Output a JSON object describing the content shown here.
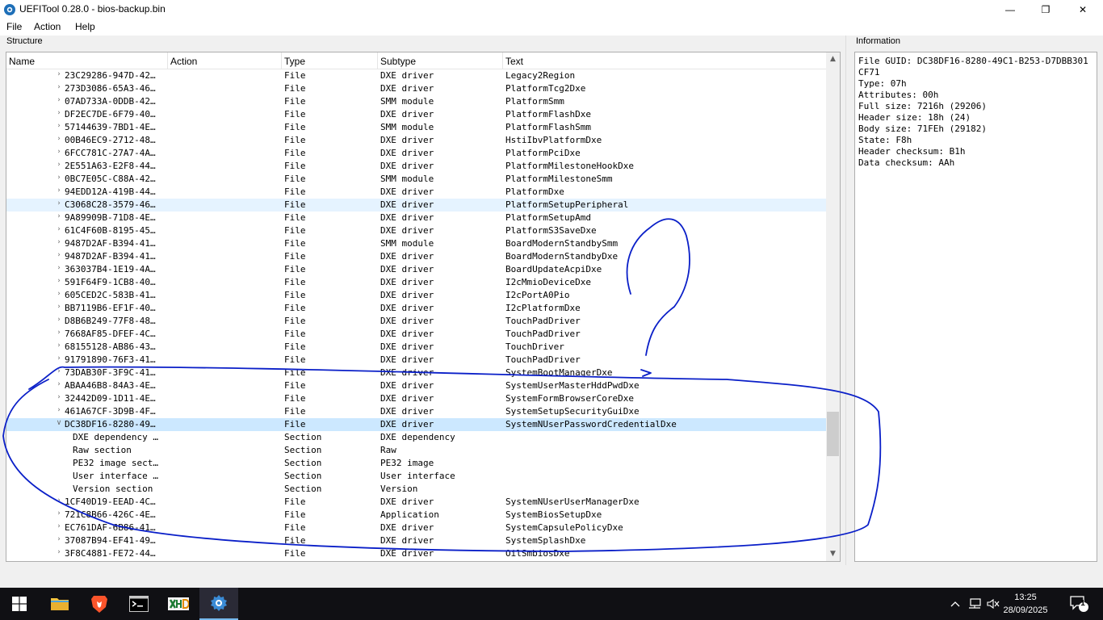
{
  "window": {
    "title": "UEFITool 0.28.0 - bios-backup.bin",
    "minimize_glyph": "—",
    "maximize_glyph": "❐",
    "close_glyph": "✕"
  },
  "menu": [
    "File",
    "Action",
    "Help"
  ],
  "structure_title": "Structure",
  "information_title": "Information",
  "columns": {
    "name": "Name",
    "action": "Action",
    "type": "Type",
    "subtype": "Subtype",
    "text": "Text"
  },
  "rows": [
    {
      "name": "23C29286-947D-42…",
      "type": "File",
      "subtype": "DXE driver",
      "text": "Legacy2Region",
      "level": 0,
      "expander": "collapsed"
    },
    {
      "name": "273D3086-65A3-46…",
      "type": "File",
      "subtype": "DXE driver",
      "text": "PlatformTcg2Dxe",
      "level": 0,
      "expander": "collapsed"
    },
    {
      "name": "07AD733A-0DDB-42…",
      "type": "File",
      "subtype": "SMM module",
      "text": "PlatformSmm",
      "level": 0,
      "expander": "collapsed"
    },
    {
      "name": "DF2EC7DE-6F79-40…",
      "type": "File",
      "subtype": "DXE driver",
      "text": "PlatformFlashDxe",
      "level": 0,
      "expander": "collapsed"
    },
    {
      "name": "57144639-7BD1-4E…",
      "type": "File",
      "subtype": "SMM module",
      "text": "PlatformFlashSmm",
      "level": 0,
      "expander": "collapsed"
    },
    {
      "name": "00B46EC9-2712-48…",
      "type": "File",
      "subtype": "DXE driver",
      "text": "HstiIbvPlatformDxe",
      "level": 0,
      "expander": "collapsed"
    },
    {
      "name": "6FCC781C-27A7-4A…",
      "type": "File",
      "subtype": "DXE driver",
      "text": "PlatformPciDxe",
      "level": 0,
      "expander": "collapsed"
    },
    {
      "name": "2E551A63-E2F8-44…",
      "type": "File",
      "subtype": "DXE driver",
      "text": "PlatformMilestoneHookDxe",
      "level": 0,
      "expander": "collapsed"
    },
    {
      "name": "0BC7E05C-C88A-42…",
      "type": "File",
      "subtype": "SMM module",
      "text": "PlatformMilestoneSmm",
      "level": 0,
      "expander": "collapsed"
    },
    {
      "name": "94EDD12A-419B-44…",
      "type": "File",
      "subtype": "DXE driver",
      "text": "PlatformDxe",
      "level": 0,
      "expander": "collapsed"
    },
    {
      "name": "C3068C28-3579-46…",
      "type": "File",
      "subtype": "DXE driver",
      "text": "PlatformSetupPeripheral",
      "level": 0,
      "expander": "collapsed",
      "state": "hover"
    },
    {
      "name": "9A89909B-71D8-4E…",
      "type": "File",
      "subtype": "DXE driver",
      "text": "PlatformSetupAmd",
      "level": 0,
      "expander": "collapsed"
    },
    {
      "name": "61C4F60B-8195-45…",
      "type": "File",
      "subtype": "DXE driver",
      "text": "PlatformS3SaveDxe",
      "level": 0,
      "expander": "collapsed"
    },
    {
      "name": "9487D2AF-B394-41…",
      "type": "File",
      "subtype": "SMM module",
      "text": "BoardModernStandbySmm",
      "level": 0,
      "expander": "collapsed"
    },
    {
      "name": "9487D2AF-B394-41…",
      "type": "File",
      "subtype": "DXE driver",
      "text": "BoardModernStandbyDxe",
      "level": 0,
      "expander": "collapsed"
    },
    {
      "name": "363037B4-1E19-4A…",
      "type": "File",
      "subtype": "DXE driver",
      "text": "BoardUpdateAcpiDxe",
      "level": 0,
      "expander": "collapsed"
    },
    {
      "name": "591F64F9-1CB8-40…",
      "type": "File",
      "subtype": "DXE driver",
      "text": "I2cMmioDeviceDxe",
      "level": 0,
      "expander": "collapsed"
    },
    {
      "name": "605CED2C-583B-41…",
      "type": "File",
      "subtype": "DXE driver",
      "text": "I2cPortA0Pio",
      "level": 0,
      "expander": "collapsed"
    },
    {
      "name": "BB7119B6-EF1F-40…",
      "type": "File",
      "subtype": "DXE driver",
      "text": "I2cPlatformDxe",
      "level": 0,
      "expander": "collapsed"
    },
    {
      "name": "D8B6B249-77F8-48…",
      "type": "File",
      "subtype": "DXE driver",
      "text": "TouchPadDriver",
      "level": 0,
      "expander": "collapsed"
    },
    {
      "name": "7668AF85-DFEF-4C…",
      "type": "File",
      "subtype": "DXE driver",
      "text": "TouchPadDriver",
      "level": 0,
      "expander": "collapsed"
    },
    {
      "name": "68155128-AB86-43…",
      "type": "File",
      "subtype": "DXE driver",
      "text": "TouchDriver",
      "level": 0,
      "expander": "collapsed"
    },
    {
      "name": "91791890-76F3-41…",
      "type": "File",
      "subtype": "DXE driver",
      "text": "TouchPadDriver",
      "level": 0,
      "expander": "collapsed"
    },
    {
      "name": "73DAB30F-3F9C-41…",
      "type": "File",
      "subtype": "DXE driver",
      "text": "SystemBootManagerDxe",
      "level": 0,
      "expander": "collapsed"
    },
    {
      "name": "ABAA46B8-84A3-4E…",
      "type": "File",
      "subtype": "DXE driver",
      "text": "SystemUserMasterHddPwdDxe",
      "level": 0,
      "expander": "collapsed"
    },
    {
      "name": "32442D09-1D11-4E…",
      "type": "File",
      "subtype": "DXE driver",
      "text": "SystemFormBrowserCoreDxe",
      "level": 0,
      "expander": "collapsed"
    },
    {
      "name": "461A67CF-3D9B-4F…",
      "type": "File",
      "subtype": "DXE driver",
      "text": "SystemSetupSecurityGuiDxe",
      "level": 0,
      "expander": "collapsed"
    },
    {
      "name": "DC38DF16-8280-49…",
      "type": "File",
      "subtype": "DXE driver",
      "text": "SystemNUserPasswordCredentialDxe",
      "level": 0,
      "expander": "expanded",
      "state": "selected"
    },
    {
      "name": "DXE dependency …",
      "type": "Section",
      "subtype": "DXE dependency",
      "text": "",
      "level": 1,
      "expander": "none"
    },
    {
      "name": "Raw section",
      "type": "Section",
      "subtype": "Raw",
      "text": "",
      "level": 1,
      "expander": "none"
    },
    {
      "name": "PE32 image sect…",
      "type": "Section",
      "subtype": "PE32 image",
      "text": "",
      "level": 1,
      "expander": "none"
    },
    {
      "name": "User interface …",
      "type": "Section",
      "subtype": "User interface",
      "text": "",
      "level": 1,
      "expander": "none"
    },
    {
      "name": "Version section",
      "type": "Section",
      "subtype": "Version",
      "text": "",
      "level": 1,
      "expander": "none"
    },
    {
      "name": "1CF40D19-EEAD-4C…",
      "type": "File",
      "subtype": "DXE driver",
      "text": "SystemNUserUserManagerDxe",
      "level": 0,
      "expander": "collapsed"
    },
    {
      "name": "721C8B66-426C-4E…",
      "type": "File",
      "subtype": "Application",
      "text": "SystemBiosSetupDxe",
      "level": 0,
      "expander": "collapsed"
    },
    {
      "name": "EC761DAF-6B86-41…",
      "type": "File",
      "subtype": "DXE driver",
      "text": "SystemCapsulePolicyDxe",
      "level": 0,
      "expander": "collapsed"
    },
    {
      "name": "37087B94-EF41-49…",
      "type": "File",
      "subtype": "DXE driver",
      "text": "SystemSplashDxe",
      "level": 0,
      "expander": "collapsed"
    },
    {
      "name": "3F8C4881-FE72-44…",
      "type": "File",
      "subtype": "DXE driver",
      "text": "OilSmbiosDxe",
      "level": 0,
      "expander": "collapsed"
    }
  ],
  "information": {
    "lines": [
      "File GUID: DC38DF16-8280-49C1-B253-D7DBB301CF71",
      "Type: 07h",
      "Attributes: 00h",
      "Full size: 7216h (29206)",
      "Header size: 18h (24)",
      "Body size: 71FEh (29182)",
      "State: F8h",
      "Header checksum: B1h",
      "Data checksum: AAh"
    ]
  },
  "taskbar": {
    "time": "13:25",
    "date": "28/09/2025",
    "notification_count": "1",
    "accent": "#76b9ed"
  },
  "annotation": {
    "color": "#0a1fc8",
    "question_mark": "?"
  }
}
